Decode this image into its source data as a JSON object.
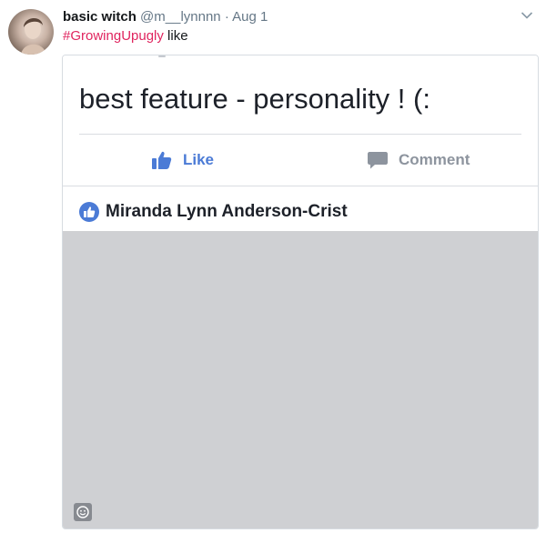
{
  "tweet": {
    "display_name": "basic witch",
    "handle": "@m__lynnnn",
    "separator": "·",
    "date": "Aug 1",
    "hashtag": "#GrowingUpugly",
    "text_rest": " like"
  },
  "embedded_post": {
    "text": "best feature - personality ! (:",
    "actions": {
      "like_label": "Like",
      "comment_label": "Comment"
    },
    "liker_name": "Miranda Lynn Anderson-Crist"
  },
  "colors": {
    "hashtag": "#e0245e",
    "like_blue": "#4b7bd6",
    "photo_gray": "#cfd0d3"
  },
  "icons": [
    "caret-down-icon",
    "thumbs-up-icon",
    "comment-icon",
    "like-badge-icon",
    "emoji-icon"
  ]
}
